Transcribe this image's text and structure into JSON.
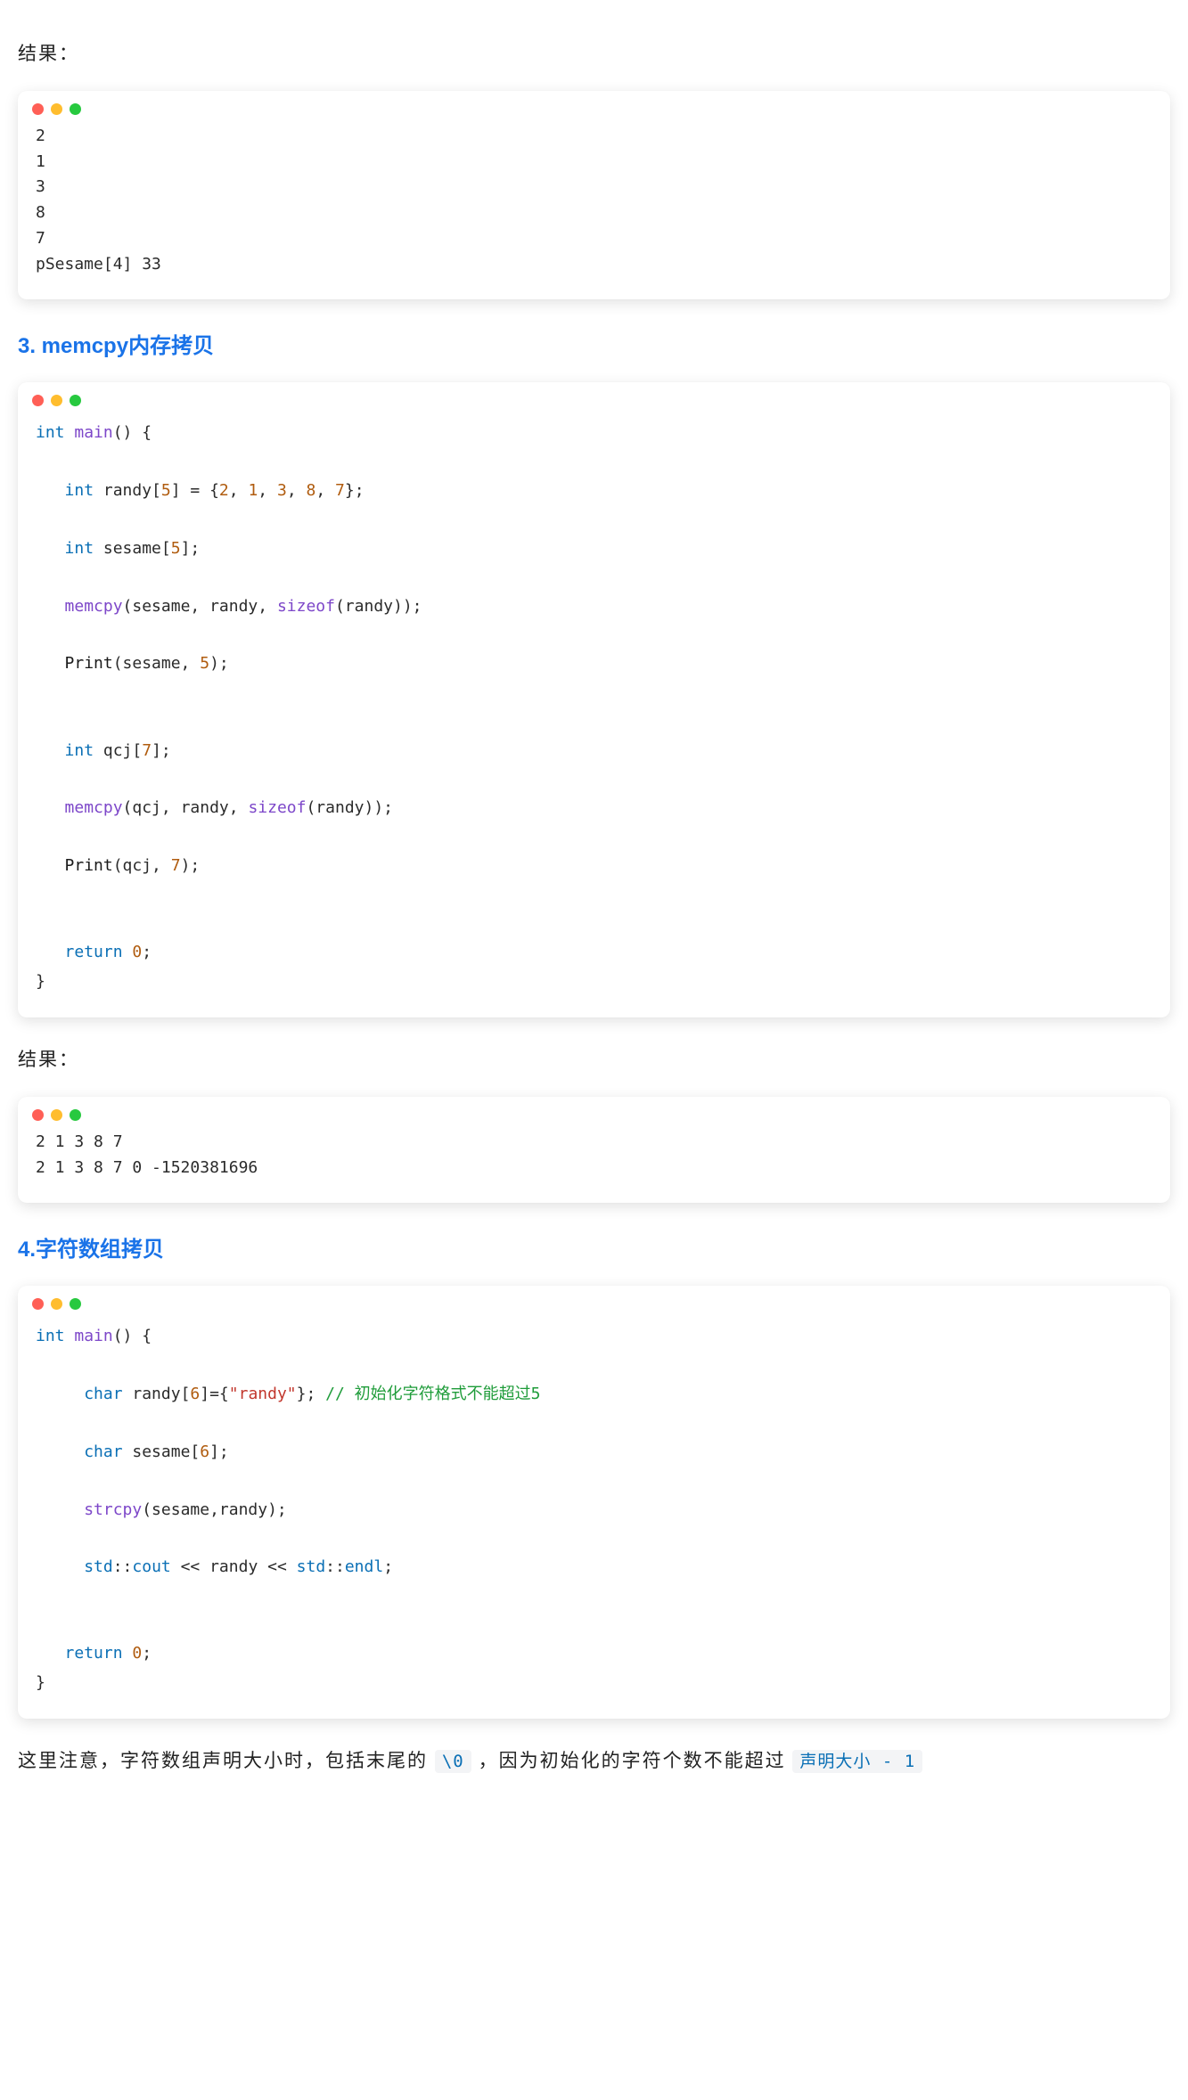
{
  "sections": {
    "result_label_1": "结果：",
    "heading_3": "3. memcpy内存拷贝",
    "result_label_2": "结果：",
    "heading_4": "4.字符数组拷贝",
    "note_prefix": "这里注意，字符数组声明大小时，包括末尾的 ",
    "note_code_1": "\\0",
    "note_mid": " ，因为初始化的字符个数不能超过 ",
    "note_code_2": "声明大小  -  1"
  },
  "output_1_lines": [
    "2",
    "1",
    "3",
    "8",
    "7",
    "pSesame[4] 33"
  ],
  "code_2": {
    "l1_kw": "int",
    "l1_fn": "main",
    "l1_rest": "() {",
    "l2_kw": "int",
    "l2_name": " randy[",
    "l2_n5": "5",
    "l2_eq": "] = {",
    "l2_v1": "2",
    "l2_c": ", ",
    "l2_v2": "1",
    "l2_v3": "3",
    "l2_v4": "8",
    "l2_v5": "7",
    "l2_end": "};",
    "l3_kw": "int",
    "l3_rest": " sesame[",
    "l3_n5": "5",
    "l3_end": "];",
    "l4_fn": "memcpy",
    "l4_args1": "(sesame, randy, ",
    "l4_sizeof": "sizeof",
    "l4_args2": "(randy));",
    "l5_fn": "Print",
    "l5_args": "(sesame, ",
    "l5_n5": "5",
    "l5_end": ");",
    "l6_kw": "int",
    "l6_rest": " qcj[",
    "l6_n7": "7",
    "l6_end": "];",
    "l7_fn": "memcpy",
    "l7_args1": "(qcj, randy, ",
    "l7_sizeof": "sizeof",
    "l7_args2": "(randy));",
    "l8_fn": "Print",
    "l8_args": "(qcj, ",
    "l8_n7": "7",
    "l8_end": ");",
    "l9_kw": "return",
    "l9_sp": " ",
    "l9_n0": "0",
    "l9_end": ";",
    "l10": "}"
  },
  "output_2_lines": [
    "2 1 3 8 7",
    "2 1 3 8 7 0 -1520381696"
  ],
  "code_3": {
    "l1_kw": "int",
    "l1_fn": "main",
    "l1_rest": "() {",
    "l2_kw": "char",
    "l2_mid": " randy[",
    "l2_n6": "6",
    "l2_eq": "]={",
    "l2_str": "\"randy\"",
    "l2_end": "}; ",
    "l2_cmt": "// 初始化字符格式不能超过5",
    "l3_kw": "char",
    "l3_mid": " sesame[",
    "l3_n6": "6",
    "l3_end": "];",
    "l4_fn": "strcpy",
    "l4_args": "(sesame,randy);",
    "l5_std1": "std",
    "l5_op1": "::",
    "l5_cout": "cout",
    "l5_op2": " << randy << ",
    "l5_std2": "std",
    "l5_op3": "::",
    "l5_endl": "endl",
    "l5_end": ";",
    "l6_kw": "return",
    "l6_sp": " ",
    "l6_n0": "0",
    "l6_end": ";",
    "l7": "}"
  }
}
